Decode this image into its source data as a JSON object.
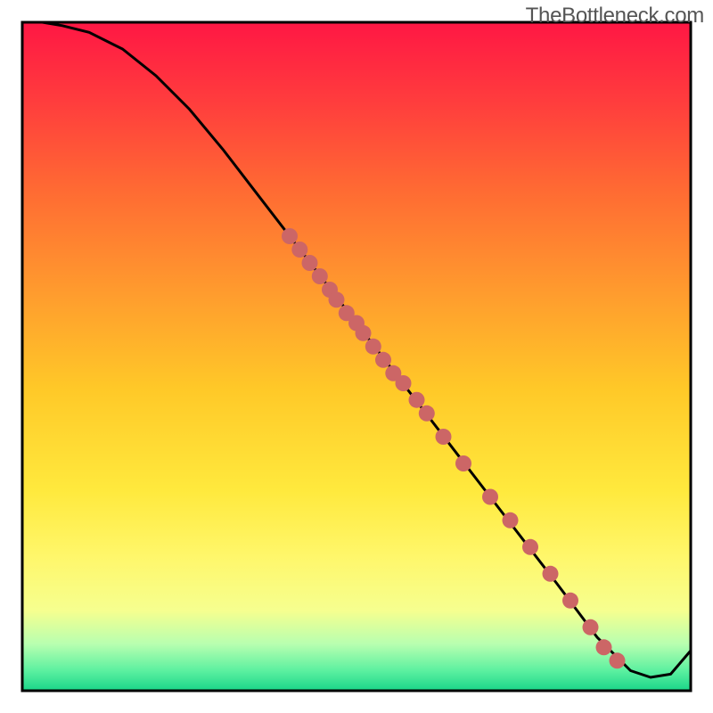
{
  "watermark": "TheBottleneck.com",
  "chart_data": {
    "type": "line",
    "title": "",
    "xlabel": "",
    "ylabel": "",
    "xlim": [
      0,
      100
    ],
    "ylim": [
      0,
      100
    ],
    "line": {
      "x": [
        3,
        6,
        10,
        15,
        20,
        25,
        30,
        35,
        40,
        45,
        50,
        55,
        60,
        65,
        70,
        75,
        80,
        83,
        86,
        89,
        91,
        94,
        97,
        100
      ],
      "y": [
        100,
        99.5,
        98.5,
        96,
        92,
        87,
        81,
        74.5,
        68,
        61.5,
        55,
        48.5,
        42,
        35.5,
        29,
        22.5,
        16,
        12,
        8,
        5,
        3,
        2,
        2.5,
        6
      ]
    },
    "points": {
      "x": [
        40,
        41.5,
        43,
        44.5,
        46,
        47,
        48.5,
        50,
        51,
        52.5,
        54,
        55.5,
        57,
        59,
        60.5,
        63,
        66,
        70,
        73,
        76,
        79,
        82,
        85,
        87,
        89
      ],
      "y": [
        68,
        66,
        64,
        62,
        60,
        58.5,
        56.5,
        55,
        53.5,
        51.5,
        49.5,
        47.5,
        46,
        43.5,
        41.5,
        38,
        34,
        29,
        25.5,
        21.5,
        17.5,
        13.5,
        9.5,
        6.5,
        4.5
      ]
    },
    "colors": {
      "line": "#000000",
      "point_fill": "#cc6666",
      "border": "#000000"
    },
    "gradient_stops": [
      {
        "offset": 0.0,
        "color": "#ff1744"
      },
      {
        "offset": 0.12,
        "color": "#ff3d3d"
      },
      {
        "offset": 0.25,
        "color": "#ff6a33"
      },
      {
        "offset": 0.4,
        "color": "#ff9a2e"
      },
      {
        "offset": 0.55,
        "color": "#ffc928"
      },
      {
        "offset": 0.7,
        "color": "#ffe93d"
      },
      {
        "offset": 0.8,
        "color": "#fff76b"
      },
      {
        "offset": 0.88,
        "color": "#f6ff8f"
      },
      {
        "offset": 0.93,
        "color": "#b8ffb0"
      },
      {
        "offset": 0.97,
        "color": "#5cf0a0"
      },
      {
        "offset": 1.0,
        "color": "#1ad68a"
      }
    ]
  }
}
